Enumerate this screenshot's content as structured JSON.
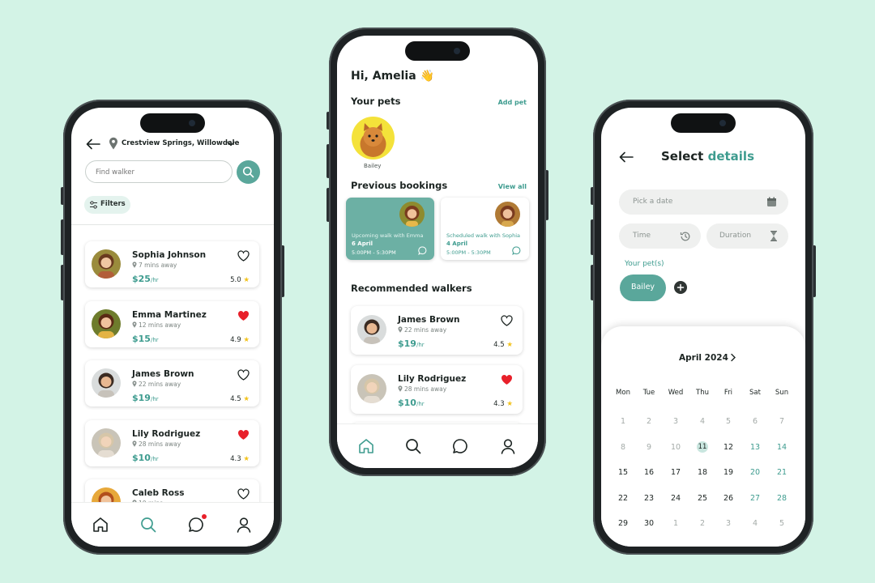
{
  "colors": {
    "background": "#d3f3e6",
    "accent": "#3e9c8f",
    "heart_active": "#e8202a",
    "star": "#f2c21b"
  },
  "left": {
    "location": "Crestview Springs, Willowdale",
    "search_placeholder": "Find walker",
    "filters_label": "Filters",
    "walkers": [
      {
        "name": "Sophia Johnson",
        "distance": "7 mins away",
        "price": "$25",
        "unit": "/hr",
        "rating": "5.0",
        "favorite": false
      },
      {
        "name": "Emma Martinez",
        "distance": "12 mins away",
        "price": "$15",
        "unit": "/hr",
        "rating": "4.9",
        "favorite": true
      },
      {
        "name": "James Brown",
        "distance": "22 mins away",
        "price": "$19",
        "unit": "/hr",
        "rating": "4.5",
        "favorite": false
      },
      {
        "name": "Lily Rodriguez",
        "distance": "28 mins away",
        "price": "$10",
        "unit": "/hr",
        "rating": "4.3",
        "favorite": true
      },
      {
        "name": "Caleb Ross",
        "distance": "10 mins",
        "price": "",
        "unit": "",
        "rating": "",
        "favorite": false
      }
    ],
    "tabs": [
      "home-icon",
      "search-icon",
      "chat-icon",
      "profile-icon"
    ],
    "active_tab": "search-icon"
  },
  "middle": {
    "greeting": "Hi, Amelia 👋",
    "pets_heading": "Your pets",
    "add_pet": "Add pet",
    "pet_name": "Bailey",
    "bookings_heading": "Previous bookings",
    "view_all": "View all",
    "bookings": [
      {
        "title": "Upcoming walk with Emma",
        "date": "6 April",
        "time": "5:00PM - 5:30PM"
      },
      {
        "title": "Scheduled walk with Sophia",
        "date": "4 April",
        "time": "5:00PM - 5:30PM"
      }
    ],
    "recommended_heading": "Recommended walkers",
    "walkers": [
      {
        "name": "James Brown",
        "distance": "22 mins away",
        "price": "$19",
        "unit": "/hr",
        "rating": "4.5",
        "favorite": false
      },
      {
        "name": "Lily Rodriguez",
        "distance": "28 mins away",
        "price": "$10",
        "unit": "/hr",
        "rating": "4.3",
        "favorite": true
      }
    ],
    "active_tab": "home-icon"
  },
  "right": {
    "title_prefix": "Select ",
    "title_accent": "details",
    "date_placeholder": "Pick a date",
    "time_placeholder": "Time",
    "duration_placeholder": "Duration",
    "pets_label": "Your pet(s)",
    "selected_pet": "Bailey",
    "month": "April 2024",
    "weekdays": [
      "Mon",
      "Tue",
      "Wed",
      "Thu",
      "Fri",
      "Sat",
      "Sun"
    ],
    "weeks": [
      [
        "1",
        "2",
        "3",
        "4",
        "5",
        "6",
        "7"
      ],
      [
        "8",
        "9",
        "10",
        "11",
        "12",
        "13",
        "14"
      ],
      [
        "15",
        "16",
        "17",
        "18",
        "19",
        "20",
        "21"
      ],
      [
        "22",
        "23",
        "24",
        "25",
        "26",
        "27",
        "28"
      ],
      [
        "29",
        "30",
        "1",
        "2",
        "3",
        "4",
        "5"
      ]
    ],
    "today": "11"
  }
}
